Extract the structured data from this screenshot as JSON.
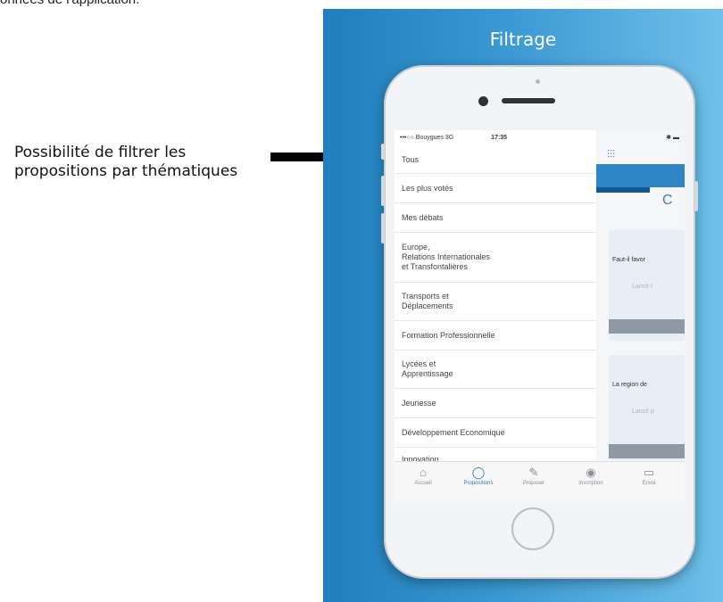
{
  "caption": {
    "top_text": "onnées de l'application."
  },
  "annotation": {
    "text": "Possibilité de filtrer les propositions par thématiques"
  },
  "panel": {
    "title": "Filtrage"
  },
  "status": {
    "carrier": "•••○○ Bouygues  3G",
    "time": "17:35"
  },
  "filter_menu": [
    "Tous",
    "Les plus votés",
    "Mes débats",
    "Europe,\nRelations Internationales\net Transfontalières",
    "Transports et\nDéplacements",
    "Formation Professionnelle",
    "Lycées et\nApprentissage",
    "Jeunesse",
    "Développement Economique",
    "Innovation"
  ],
  "right_pane": {
    "status": "✱ ▬",
    "filter_icon": "sliders-icon",
    "card1_title": "Faut-il favor",
    "card1_sub": "Lancé I",
    "card2_title": "La region de",
    "card2_sub": "Lancé p"
  },
  "tabbar": [
    {
      "label": "Accueil",
      "icon": "home-icon"
    },
    {
      "label": "Propositions",
      "icon": "chat-icon"
    },
    {
      "label": "Proposer",
      "icon": "pencil-icon"
    },
    {
      "label": "Inscription",
      "icon": "user-icon"
    },
    {
      "label": "Envoi",
      "icon": "message-icon"
    }
  ]
}
